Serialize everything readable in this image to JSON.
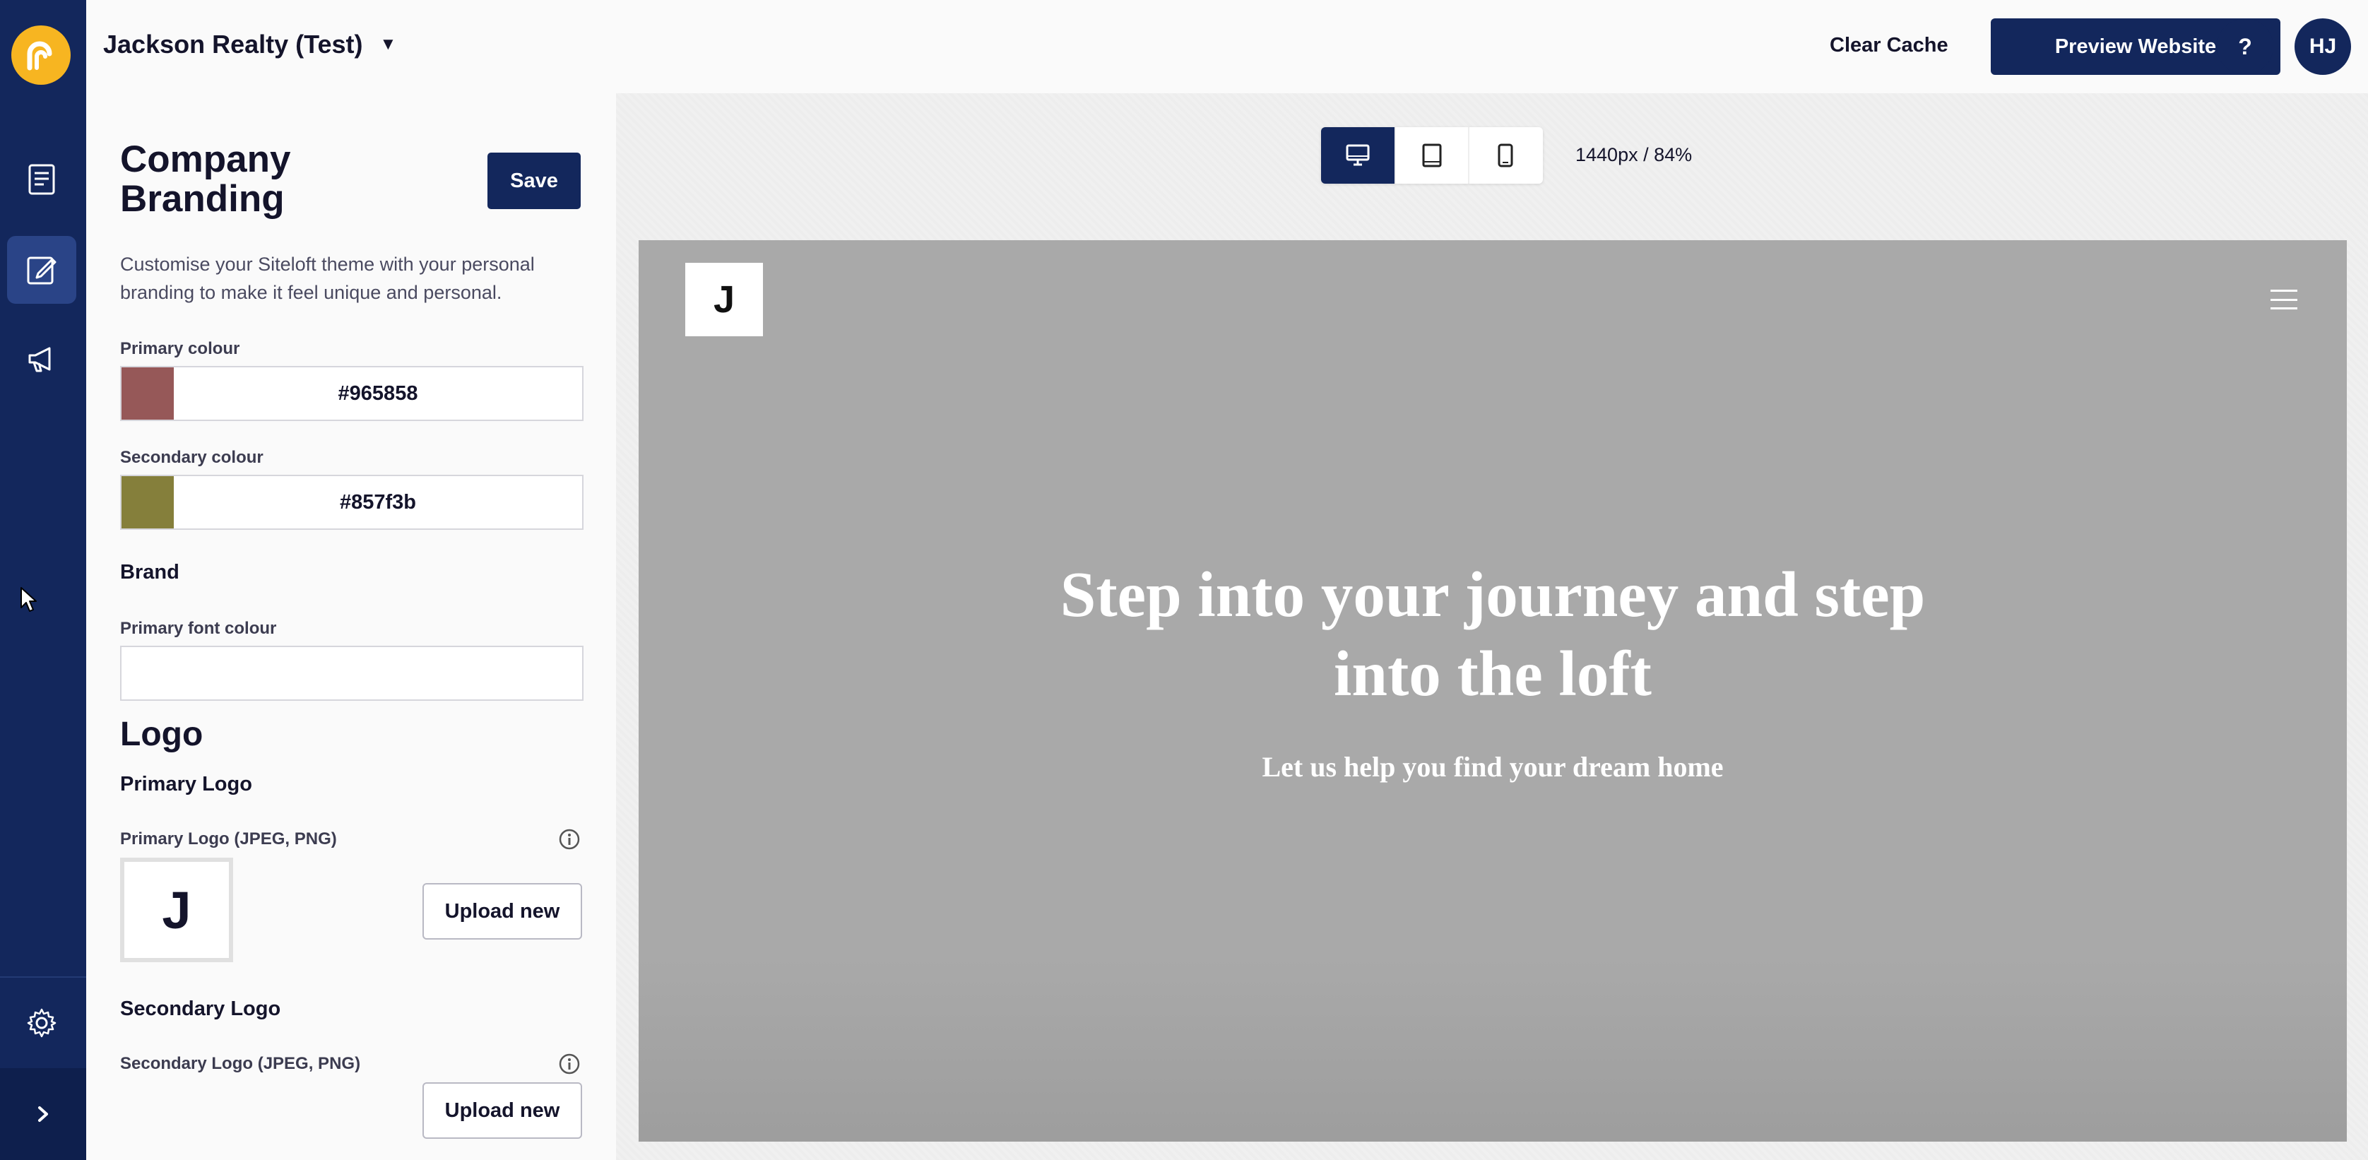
{
  "app": {
    "brand_color": "#13275c",
    "logo_color": "#f7b521"
  },
  "topbar": {
    "site_name": "Jackson Realty (Test)",
    "site_caret": "▼",
    "clear_cache": "Clear Cache",
    "preview_label": "Preview Website",
    "help_label": "?",
    "avatar_initials": "HJ"
  },
  "sidebar": {
    "items": [
      {
        "icon": "pages-icon",
        "active": false
      },
      {
        "icon": "edit-design-icon",
        "active": true
      },
      {
        "icon": "megaphone-icon",
        "active": false
      }
    ],
    "settings_icon": "gear-icon",
    "expand_icon": "chevron-right-icon"
  },
  "panel": {
    "title": "Company Branding",
    "save_label": "Save",
    "description": "Customise your Siteloft theme with your personal branding to make it feel unique and personal.",
    "primary_colour": {
      "label": "Primary colour",
      "value": "#965858"
    },
    "secondary_colour": {
      "label": "Secondary colour",
      "value": "#857f3b"
    },
    "brand_heading": "Brand",
    "primary_font_colour": {
      "label": "Primary font colour",
      "value": ""
    },
    "logo_heading": "Logo",
    "primary_logo": {
      "heading": "Primary Logo",
      "field_label": "Primary Logo (JPEG, PNG)",
      "preview_letter": "J",
      "upload_label": "Upload new"
    },
    "secondary_logo": {
      "heading": "Secondary Logo",
      "field_label": "Secondary Logo (JPEG, PNG)",
      "upload_label": "Upload new"
    }
  },
  "preview": {
    "devices": [
      "desktop-icon",
      "tablet-icon",
      "mobile-icon"
    ],
    "active_device": "desktop-icon",
    "viewport_info": "1440px / 84%",
    "site_logo_letter": "J",
    "hero_title_line1": "Step into your journey and step",
    "hero_title_line2": "into the loft",
    "hero_subtitle": "Let us help you find your dream home",
    "background_color": "#a9a9a9"
  }
}
